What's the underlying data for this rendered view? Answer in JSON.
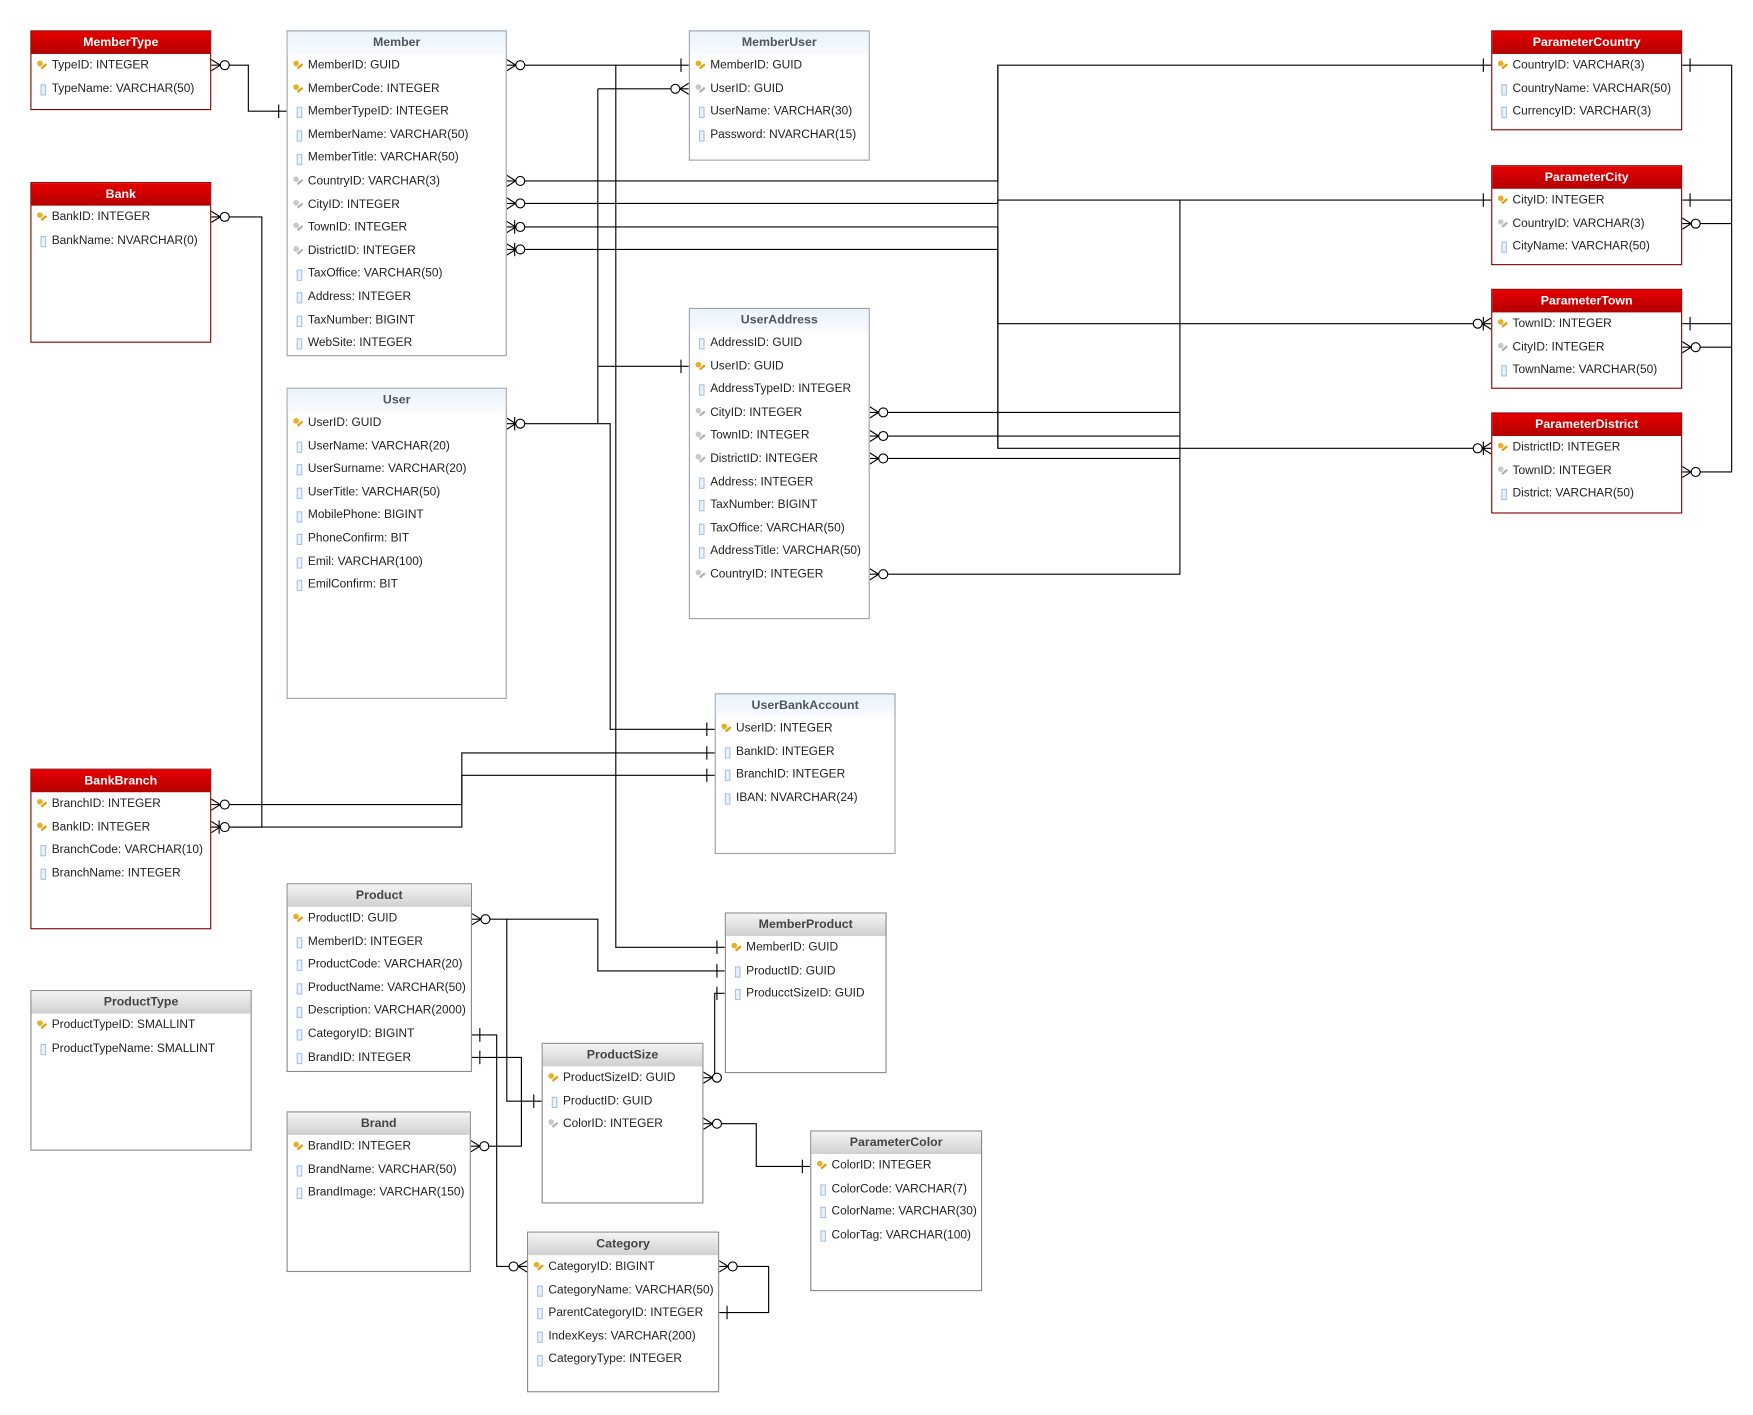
{
  "theme_colors": {
    "red_header": "#cc0000",
    "blue_header": "#eaf4fc",
    "gray_header": "#dcdcdc",
    "line": "#000000"
  },
  "tables": [
    {
      "name": "MemberType",
      "theme": "red",
      "columns": [
        {
          "icon": "primary-key",
          "text": "TypeID: INTEGER"
        },
        {
          "icon": "column",
          "text": "TypeName: VARCHAR(50)"
        }
      ]
    },
    {
      "name": "Bank",
      "theme": "red",
      "columns": [
        {
          "icon": "primary-key",
          "text": "BankID: INTEGER"
        },
        {
          "icon": "column",
          "text": "BankName: NVARCHAR(0)"
        }
      ]
    },
    {
      "name": "Member",
      "theme": "blue",
      "columns": [
        {
          "icon": "primary-key",
          "text": "MemberID: GUID"
        },
        {
          "icon": "primary-key",
          "text": "MemberCode: INTEGER"
        },
        {
          "icon": "column",
          "text": "MemberTypeID: INTEGER"
        },
        {
          "icon": "column",
          "text": "MemberName: VARCHAR(50)"
        },
        {
          "icon": "column",
          "text": "MemberTitle: VARCHAR(50)"
        },
        {
          "icon": "foreign-key",
          "text": "CountryID: VARCHAR(3)"
        },
        {
          "icon": "foreign-key",
          "text": "CityID: INTEGER"
        },
        {
          "icon": "foreign-key",
          "text": "TownID: INTEGER"
        },
        {
          "icon": "foreign-key",
          "text": "DistrictID: INTEGER"
        },
        {
          "icon": "column",
          "text": "TaxOffice: VARCHAR(50)"
        },
        {
          "icon": "column",
          "text": "Address: INTEGER"
        },
        {
          "icon": "column",
          "text": "TaxNumber: BIGINT"
        },
        {
          "icon": "column",
          "text": "WebSite: INTEGER"
        }
      ]
    },
    {
      "name": "User",
      "theme": "blue",
      "columns": [
        {
          "icon": "primary-key",
          "text": "UserID: GUID"
        },
        {
          "icon": "column",
          "text": "UserName: VARCHAR(20)"
        },
        {
          "icon": "column",
          "text": "UserSurname: VARCHAR(20)"
        },
        {
          "icon": "column",
          "text": "UserTitle: VARCHAR(50)"
        },
        {
          "icon": "column",
          "text": "MobilePhone: BIGINT"
        },
        {
          "icon": "column",
          "text": "PhoneConfirm: BIT"
        },
        {
          "icon": "column",
          "text": "Emil: VARCHAR(100)"
        },
        {
          "icon": "column",
          "text": "EmilConfirm: BIT"
        }
      ]
    },
    {
      "name": "MemberUser",
      "theme": "blue",
      "columns": [
        {
          "icon": "primary-key",
          "text": "MemberID: GUID"
        },
        {
          "icon": "foreign-key",
          "text": "UserID: GUID"
        },
        {
          "icon": "column",
          "text": "UserName: VARCHAR(30)"
        },
        {
          "icon": "column",
          "text": "Password: NVARCHAR(15)"
        }
      ]
    },
    {
      "name": "UserAddress",
      "theme": "blue",
      "columns": [
        {
          "icon": "column",
          "text": "AddressID: GUID"
        },
        {
          "icon": "primary-key",
          "text": "UserID: GUID"
        },
        {
          "icon": "column",
          "text": "AddressTypeID: INTEGER"
        },
        {
          "icon": "foreign-key",
          "text": "CityID: INTEGER"
        },
        {
          "icon": "foreign-key",
          "text": "TownID: INTEGER"
        },
        {
          "icon": "foreign-key",
          "text": "DistrictID: INTEGER"
        },
        {
          "icon": "column",
          "text": "Address: INTEGER"
        },
        {
          "icon": "column",
          "text": "TaxNumber: BIGINT"
        },
        {
          "icon": "column",
          "text": "TaxOffice: VARCHAR(50)"
        },
        {
          "icon": "column",
          "text": "AddressTitle: VARCHAR(50)"
        },
        {
          "icon": "foreign-key",
          "text": "CountryID: INTEGER"
        }
      ]
    },
    {
      "name": "UserBankAccount",
      "theme": "blue",
      "columns": [
        {
          "icon": "primary-key",
          "text": "UserID: INTEGER"
        },
        {
          "icon": "column",
          "text": "BankID: INTEGER"
        },
        {
          "icon": "column",
          "text": "BranchID: INTEGER"
        },
        {
          "icon": "column",
          "text": "IBAN: NVARCHAR(24)"
        }
      ]
    },
    {
      "name": "ParameterCountry",
      "theme": "red",
      "columns": [
        {
          "icon": "primary-key",
          "text": "CountryID: VARCHAR(3)"
        },
        {
          "icon": "column",
          "text": "CountryName: VARCHAR(50)"
        },
        {
          "icon": "column",
          "text": "CurrencyID: VARCHAR(3)"
        }
      ]
    },
    {
      "name": "ParameterCity",
      "theme": "red",
      "columns": [
        {
          "icon": "primary-key",
          "text": "CityID: INTEGER"
        },
        {
          "icon": "foreign-key",
          "text": "CountryID: VARCHAR(3)"
        },
        {
          "icon": "column",
          "text": "CityName: VARCHAR(50)"
        }
      ]
    },
    {
      "name": "ParameterTown",
      "theme": "red",
      "columns": [
        {
          "icon": "primary-key",
          "text": "TownID: INTEGER"
        },
        {
          "icon": "foreign-key",
          "text": "CityID: INTEGER"
        },
        {
          "icon": "column",
          "text": "TownName: VARCHAR(50)"
        }
      ]
    },
    {
      "name": "ParameterDistrict",
      "theme": "red",
      "columns": [
        {
          "icon": "primary-key",
          "text": "DistrictID: INTEGER"
        },
        {
          "icon": "foreign-key",
          "text": "TownID: INTEGER"
        },
        {
          "icon": "column",
          "text": "District: VARCHAR(50)"
        }
      ]
    },
    {
      "name": "BankBranch",
      "theme": "red",
      "columns": [
        {
          "icon": "primary-key",
          "text": "BranchID: INTEGER"
        },
        {
          "icon": "primary-key",
          "text": "BankID: INTEGER"
        },
        {
          "icon": "column",
          "text": "BranchCode: VARCHAR(10)"
        },
        {
          "icon": "column",
          "text": "BranchName: INTEGER"
        }
      ]
    },
    {
      "name": "Product",
      "theme": "gray",
      "columns": [
        {
          "icon": "primary-key",
          "text": "ProductID: GUID"
        },
        {
          "icon": "column",
          "text": "MemberID: INTEGER"
        },
        {
          "icon": "column",
          "text": "ProductCode: VARCHAR(20)"
        },
        {
          "icon": "column",
          "text": "ProductName: VARCHAR(50)"
        },
        {
          "icon": "column",
          "text": "Description: VARCHAR(2000)"
        },
        {
          "icon": "column",
          "text": "CategoryID: BIGINT"
        },
        {
          "icon": "column",
          "text": "BrandID: INTEGER"
        }
      ]
    },
    {
      "name": "ProductType",
      "theme": "gray",
      "columns": [
        {
          "icon": "primary-key",
          "text": "ProductTypeID: SMALLINT"
        },
        {
          "icon": "column",
          "text": "ProductTypeName: SMALLINT"
        }
      ]
    },
    {
      "name": "Brand",
      "theme": "gray",
      "columns": [
        {
          "icon": "primary-key",
          "text": "BrandID: INTEGER"
        },
        {
          "icon": "column",
          "text": "BrandName: VARCHAR(50)"
        },
        {
          "icon": "column",
          "text": "BrandImage: VARCHAR(150)"
        }
      ]
    },
    {
      "name": "ProductSize",
      "theme": "gray",
      "columns": [
        {
          "icon": "primary-key",
          "text": "ProductSizeID: GUID"
        },
        {
          "icon": "column",
          "text": "ProductID: GUID"
        },
        {
          "icon": "foreign-key",
          "text": "ColorID: INTEGER"
        }
      ]
    },
    {
      "name": "MemberProduct",
      "theme": "gray",
      "columns": [
        {
          "icon": "primary-key",
          "text": "MemberID: GUID"
        },
        {
          "icon": "column",
          "text": "ProductID: GUID"
        },
        {
          "icon": "column",
          "text": "ProducctSizeID: GUID"
        }
      ]
    },
    {
      "name": "ParameterColor",
      "theme": "gray",
      "columns": [
        {
          "icon": "primary-key",
          "text": "ColorID: INTEGER"
        },
        {
          "icon": "column",
          "text": "ColorCode: VARCHAR(7)"
        },
        {
          "icon": "column",
          "text": "ColorName: VARCHAR(30)"
        },
        {
          "icon": "column",
          "text": "ColorTag: VARCHAR(100)"
        }
      ]
    },
    {
      "name": "Category",
      "theme": "gray",
      "columns": [
        {
          "icon": "primary-key",
          "text": "CategoryID: BIGINT"
        },
        {
          "icon": "column",
          "text": "CategoryName: VARCHAR(50)"
        },
        {
          "icon": "column",
          "text": "ParentCategoryID: INTEGER"
        },
        {
          "icon": "column",
          "text": "IndexKeys: VARCHAR(200)"
        },
        {
          "icon": "column",
          "text": "CategoryType: INTEGER"
        }
      ]
    }
  ]
}
